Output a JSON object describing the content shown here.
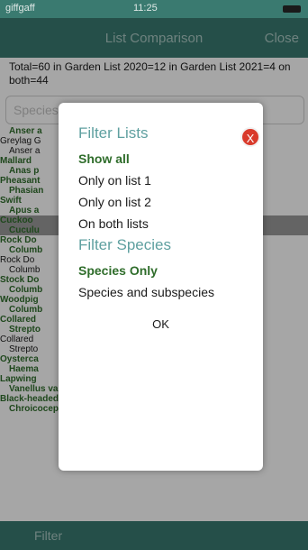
{
  "status": {
    "carrier": "giffgaff",
    "time": "11:25"
  },
  "nav": {
    "title": "List Comparison",
    "close": "Close"
  },
  "summary": "Total=60 in Garden List 2020=12 in Garden List 2021=4 on both=44",
  "search": {
    "placeholder": "Species"
  },
  "species": [
    [
      "Anser a",
      "g sp"
    ],
    [
      "Greylag G",
      "b"
    ],
    [
      "Anser a",
      "b sp"
    ],
    [
      "Mallard",
      "g"
    ],
    [
      "Anas p",
      "g sp"
    ],
    [
      "Pheasant",
      "g"
    ],
    [
      "Phasian",
      "g sp"
    ],
    [
      "Swift",
      "g"
    ],
    [
      "Apus a",
      "g sp"
    ],
    [
      "Cuckoo",
      "g hl"
    ],
    [
      "Cuculu",
      "g sp hl"
    ],
    [
      "Rock Do",
      "g"
    ],
    [
      "Columb",
      "g sp"
    ],
    [
      "Rock Do",
      "b"
    ],
    [
      "Columb",
      "b sp"
    ],
    [
      "Stock Do",
      "g"
    ],
    [
      "Columb",
      "g sp"
    ],
    [
      "Woodpig",
      "g"
    ],
    [
      "Columb",
      "g sp"
    ],
    [
      "Collared",
      "g"
    ],
    [
      "Strepto",
      "g sp"
    ],
    [
      "Collared",
      "b"
    ],
    [
      "Strepto",
      "b sp"
    ],
    [
      "Oysterca",
      "g"
    ],
    [
      "Haema",
      "g sp"
    ],
    [
      "Lapwing",
      "g"
    ],
    [
      "Vanellus vanellus",
      "g sp"
    ],
    [
      "Black-headed Gull",
      "g"
    ],
    [
      "Chroicocephalus ridibundus",
      "g sp"
    ]
  ],
  "tabbar": {
    "filter": "Filter"
  },
  "dialog": {
    "close": "X",
    "filter_lists_heading": "Filter  Lists",
    "opt_show_all": "Show all",
    "opt_only_list1": "Only on list 1",
    "opt_only_list2": "Only on list 2",
    "opt_both": "On both lists",
    "filter_species_heading": "Filter  Species",
    "opt_species_only": "Species Only",
    "opt_species_sub": "Species and subspecies",
    "ok": "OK"
  },
  "colors": {
    "header_bg": "#3a7a70",
    "green": "#2f6d2b",
    "close_red": "#d93a2b",
    "heading_teal": "#5fa0a0"
  }
}
